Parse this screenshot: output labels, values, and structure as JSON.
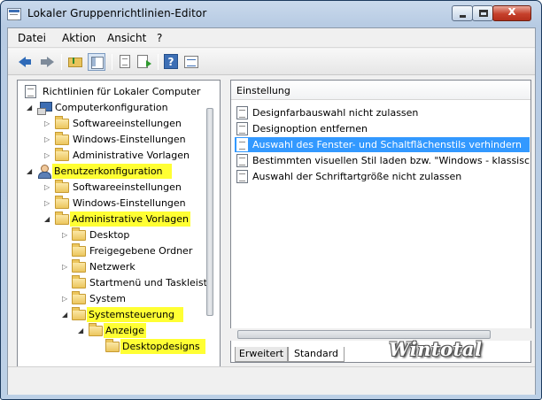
{
  "window": {
    "title": "Lokaler Gruppenrichtlinien-Editor",
    "controls": {
      "minimize": "",
      "maximize": "",
      "close": "x"
    }
  },
  "menubar": [
    "Datei",
    "Aktion",
    "Ansicht",
    "?"
  ],
  "toolbar": [
    {
      "icon": "back-arrow-icon"
    },
    {
      "icon": "forward-arrow-icon"
    },
    {
      "icon": "up-folder-icon"
    },
    {
      "icon": "show-tree-icon"
    },
    {
      "icon": "document-icon"
    },
    {
      "icon": "export-list-icon"
    },
    {
      "icon": "help-icon",
      "label": "?"
    },
    {
      "icon": "properties-icon"
    }
  ],
  "tree": [
    {
      "label": "Richtlinien für Lokaler Computer",
      "level": 0,
      "icon": "doc",
      "expander": "none",
      "highlighted": false
    },
    {
      "label": "Computerkonfiguration",
      "level": 1,
      "icon": "computer",
      "expander": "open",
      "highlighted": false
    },
    {
      "label": "Softwareeinstellungen",
      "level": 2,
      "icon": "folder",
      "expander": "closed",
      "highlighted": false
    },
    {
      "label": "Windows-Einstellungen",
      "level": 2,
      "icon": "folder",
      "expander": "closed",
      "highlighted": false
    },
    {
      "label": "Administrative Vorlagen",
      "level": 2,
      "icon": "folder",
      "expander": "closed",
      "highlighted": false
    },
    {
      "label": "Benutzerkonfiguration",
      "level": 1,
      "icon": "user",
      "expander": "open",
      "highlighted": true
    },
    {
      "label": "Softwareeinstellungen",
      "level": 2,
      "icon": "folder",
      "expander": "closed",
      "highlighted": false
    },
    {
      "label": "Windows-Einstellungen",
      "level": 2,
      "icon": "folder",
      "expander": "closed",
      "highlighted": false
    },
    {
      "label": "Administrative Vorlagen",
      "level": 2,
      "icon": "folder",
      "expander": "open",
      "highlighted": true
    },
    {
      "label": "Desktop",
      "level": 3,
      "icon": "folder",
      "expander": "closed",
      "highlighted": false
    },
    {
      "label": "Freigegebene Ordner",
      "level": 3,
      "icon": "folder",
      "expander": "none",
      "highlighted": false
    },
    {
      "label": "Netzwerk",
      "level": 3,
      "icon": "folder",
      "expander": "closed",
      "highlighted": false
    },
    {
      "label": "Startmenü und Taskleiste",
      "level": 3,
      "icon": "folder",
      "expander": "none",
      "highlighted": false
    },
    {
      "label": "System",
      "level": 3,
      "icon": "folder",
      "expander": "closed",
      "highlighted": false
    },
    {
      "label": "Systemsteuerung",
      "level": 3,
      "icon": "folder",
      "expander": "open",
      "highlighted": true
    },
    {
      "label": "Anzeige",
      "level": 4,
      "icon": "folder",
      "expander": "open",
      "highlighted": true
    },
    {
      "label": "Desktopdesigns",
      "level": 5,
      "icon": "folder",
      "expander": "none",
      "highlighted": true,
      "selected": true
    }
  ],
  "list": {
    "header": "Einstellung",
    "rows": [
      {
        "label": "Designfarbauswahl nicht zulassen",
        "selected": false
      },
      {
        "label": "Designoption entfernen",
        "selected": false
      },
      {
        "label": "Auswahl des Fenster- und Schaltflächenstils verhindern",
        "selected": true
      },
      {
        "label": "Bestimmten visuellen Stil laden bzw. \"Windows - klassisch\" ...",
        "selected": false
      },
      {
        "label": "Auswahl der Schriftartgröße nicht zulassen",
        "selected": false
      }
    ]
  },
  "tabs": [
    {
      "label": "Erweitert",
      "active": false
    },
    {
      "label": "Standard",
      "active": true
    }
  ],
  "watermark": "Wintotal",
  "statusbar": {
    "text": ""
  },
  "colors": {
    "highlight": "#ffff33",
    "selection": "#3399ff",
    "title_bar": "#bcd0e6",
    "close_button": "#c6402b"
  }
}
